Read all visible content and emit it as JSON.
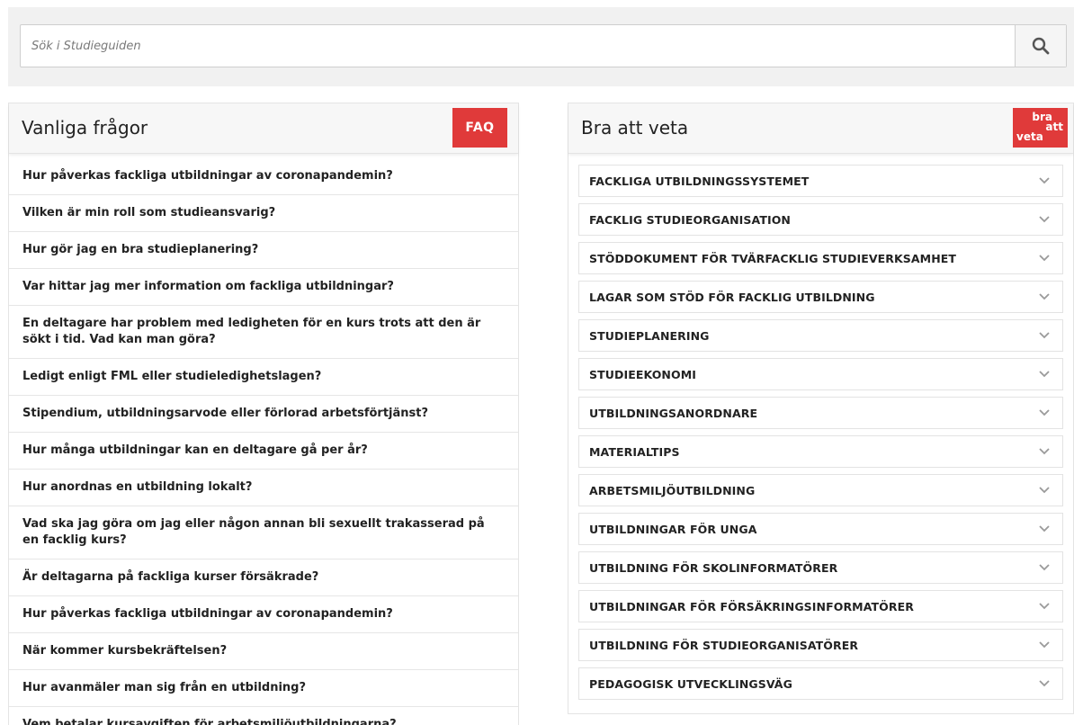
{
  "search": {
    "placeholder": "Sök i Studieguiden"
  },
  "faq": {
    "title": "Vanliga frågor",
    "badge": "FAQ",
    "items": [
      "Hur påverkas fackliga utbildningar av coronapandemin?",
      "Vilken är min roll som studieansvarig?",
      "Hur gör jag en bra studieplanering?",
      "Var hittar jag mer information om fackliga utbildningar?",
      "En deltagare har problem med ledigheten för en kurs trots att den är sökt i tid. Vad kan man göra?",
      "Ledigt enligt FML eller studieledighetslagen?",
      "Stipendium, utbildningsarvode eller förlorad arbetsförtjänst?",
      "Hur många utbildningar kan en deltagare gå per år?",
      "Hur anordnas en utbildning lokalt?",
      "Vad ska jag göra om jag eller någon annan bli sexuellt trakasserad på en facklig kurs?",
      "Är deltagarna på fackliga kurser försäkrade?",
      "Hur påverkas fackliga utbildningar av coronapandemin?",
      "När kommer kursbekräftelsen?",
      "Hur avanmäler man sig från en utbildning?",
      "Vem betalar kursavgiften för arbetsmiljöutbildningarna?"
    ]
  },
  "bra": {
    "title": "Bra att veta",
    "badge_line1": "bra",
    "badge_line2": "att",
    "badge_line3": "veta",
    "items": [
      "FACKLIGA UTBILDNINGSSYSTEMET",
      "FACKLIG STUDIEORGANISATION",
      "STÖDDOKUMENT FÖR TVÄRFACKLIG STUDIEVERKSAMHET",
      "LAGAR SOM STÖD FÖR FACKLIG UTBILDNING",
      "STUDIEPLANERING",
      "STUDIEEKONOMI",
      "UTBILDNINGSANORDNARE",
      "MATERIALTIPS",
      "ARBETSMILJÖUTBILDNING",
      "UTBILDNINGAR FÖR UNGA",
      "UTBILDNING FÖR SKOLINFORMATÖRER",
      "UTBILDNINGAR FÖR FÖRSÄKRINGSINFORMATÖRER",
      "UTBILDNING FÖR STUDIEORGANISATÖRER",
      "PEDAGOGISK UTVECKLINGSVÄG"
    ]
  },
  "colors": {
    "badge_red": "#e03a3a",
    "header_bg": "#f7f7f7",
    "search_bg": "#f1f1f1"
  },
  "icons": {
    "search": "search-icon",
    "chevron": "chevron-down-icon"
  }
}
